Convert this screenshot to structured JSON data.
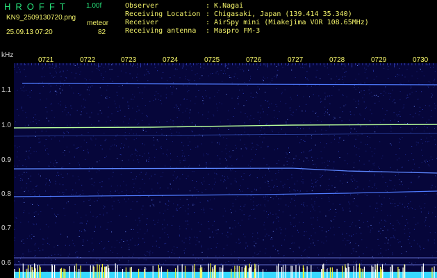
{
  "header": {
    "app_title": "HROFFT",
    "version": "1.00f",
    "file_name": "KN9_2509130720.png",
    "mode_label": "meteor",
    "datetime": "25.09.13 07:20",
    "level": "82",
    "info": [
      {
        "label": "Observer",
        "value": "K.Nagai"
      },
      {
        "label": "Receiving Location",
        "value": "Chigasaki, Japan (139.414 35.340)"
      },
      {
        "label": "Receiver",
        "value": "AirSpy mini (Miakejima VOR 108.65MHz)"
      },
      {
        "label": "Receiving antenna",
        "value": "Maspro FM-3"
      }
    ]
  },
  "axis": {
    "unit": "kHz",
    "y_ticks": [
      "1.1",
      "1.0",
      "0.9",
      "0.8",
      "0.7",
      "0.6"
    ],
    "time_ticks": [
      "0721",
      "0722",
      "0723",
      "0724",
      "0725",
      "0726",
      "0727",
      "0728",
      "0729",
      "0730"
    ]
  },
  "colors": {
    "background": "#000000",
    "plot_background": "#06063a",
    "header_text": "#f2f26a",
    "app_title": "#27e27a",
    "carrier": "#4f7bff",
    "main_carrier": "#b8ff9a",
    "bottom_band": "#37d8ff"
  }
}
